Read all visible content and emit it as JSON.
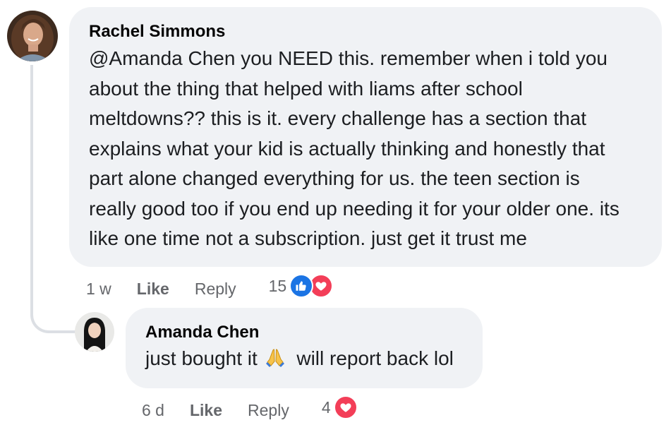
{
  "comments": [
    {
      "author": "Rachel Simmons",
      "text": "@Amanda Chen you NEED this. remember when i told you about the thing that helped with liams after school meltdowns?? this is it. every challenge has a section that explains what your kid is actually thinking and honestly that part alone changed everything for us. the teen section is really good too if you end up needing it for your older one. its like one time not a subscription. just get it trust me",
      "lines": [
        "@Amanda Chen you NEED this. remember when i told you",
        "about the thing that helped with liams after school",
        "meltdowns?? this is it. every challenge has a section that",
        "explains what your kid is actually thinking and honestly that",
        "part alone changed everything for us. the teen section is",
        "really good too if you end up needing it for your older one. its",
        "like one time not a subscription. just get it trust me"
      ],
      "time": "1 w",
      "like_label": "Like",
      "reply_label": "Reply",
      "reaction_count": "15",
      "reactions": [
        "like-icon",
        "love-icon"
      ]
    },
    {
      "author": "Amanda Chen",
      "text_before_emoji": "just bought it",
      "emoji": "folded-hands-emoji",
      "text_after_emoji": "will report back lol",
      "time": "6 d",
      "like_label": "Like",
      "reply_label": "Reply",
      "reaction_count": "4",
      "reactions": [
        "love-icon"
      ]
    }
  ],
  "colors": {
    "bubble_bg": "#f0f2f5",
    "meta_text": "#65676b",
    "like_blue": "#1b74e4",
    "love_red": "#f33e58",
    "connector": "#dcdfe4"
  }
}
